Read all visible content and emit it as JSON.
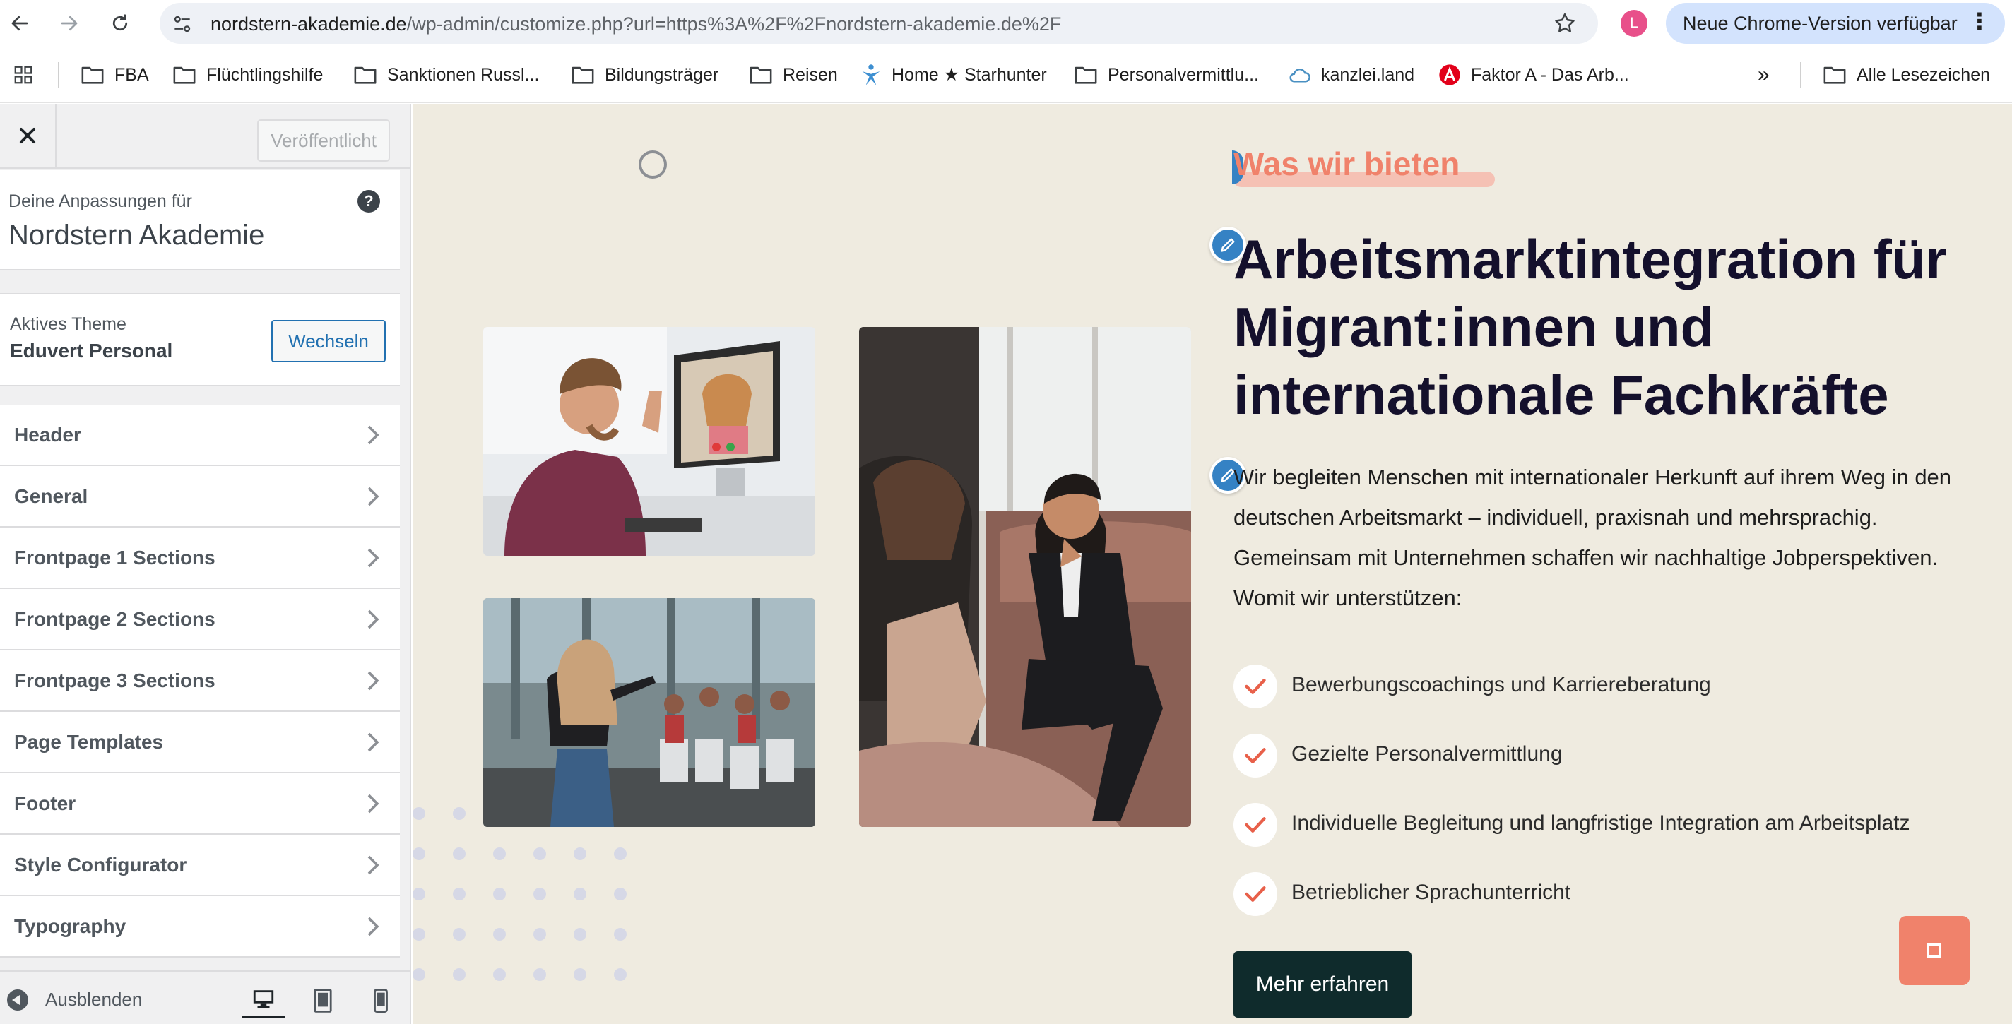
{
  "browser": {
    "url_host": "nordstern-akademie.de",
    "url_path": "/wp-admin/customize.php?url=https%3A%2F%2Fnordstern-akademie.de%2F",
    "profile_initial": "L",
    "update_label": "Neue Chrome-Version verfügbar",
    "bookmarks": [
      "FBA",
      "Flüchtlingshilfe",
      "Sanktionen Russl...",
      "Bildungsträger",
      "Reisen",
      "Home ★ Starhunter",
      "Personalvermittlu...",
      "kanzlei.land",
      "Faktor A - Das Arb..."
    ],
    "more_label": "»",
    "all_bookmarks": "Alle Lesezeichen"
  },
  "customizer": {
    "publish_label": "Veröffentlicht",
    "info_label": "Deine Anpassungen für",
    "site_name": "Nordstern Akademie",
    "theme_label": "Aktives Theme",
    "theme_name": "Eduvert Personal",
    "switch_label": "Wechseln",
    "menu": [
      "Header",
      "General",
      "Frontpage 1 Sections",
      "Frontpage 2 Sections",
      "Frontpage 3 Sections",
      "Page Templates",
      "Footer",
      "Style Configurator",
      "Typography"
    ],
    "collapse_label": "Ausblenden"
  },
  "preview": {
    "eyebrow": "Was wir bieten",
    "headline": "Arbeitsmarktintegration für Migrant:innen und internationale Fachkräfte",
    "body": "Wir begleiten Menschen mit internationaler Herkunft auf ihrem Weg in den deutschen Arbeitsmarkt – individuell, praxisnah und mehrsprachig. Gemeinsam mit Unternehmen schaffen wir nachhaltige Jobperspektiven. Womit wir unterstützen:",
    "checklist": [
      "Bewerbungscoachings und Karriereberatung",
      "Gezielte Personalvermittlung",
      "Individuelle Begleitung und langfristige Integration am Arbeitsplatz",
      "Betrieblicher Sprachunterricht"
    ],
    "cta_label": "Mehr erfahren"
  },
  "colors": {
    "accent": "#f0826b",
    "heading": "#14102c",
    "cta_bg": "#0f2b2c",
    "preview_bg": "#efebe0",
    "wp_blue": "#2271b1"
  }
}
